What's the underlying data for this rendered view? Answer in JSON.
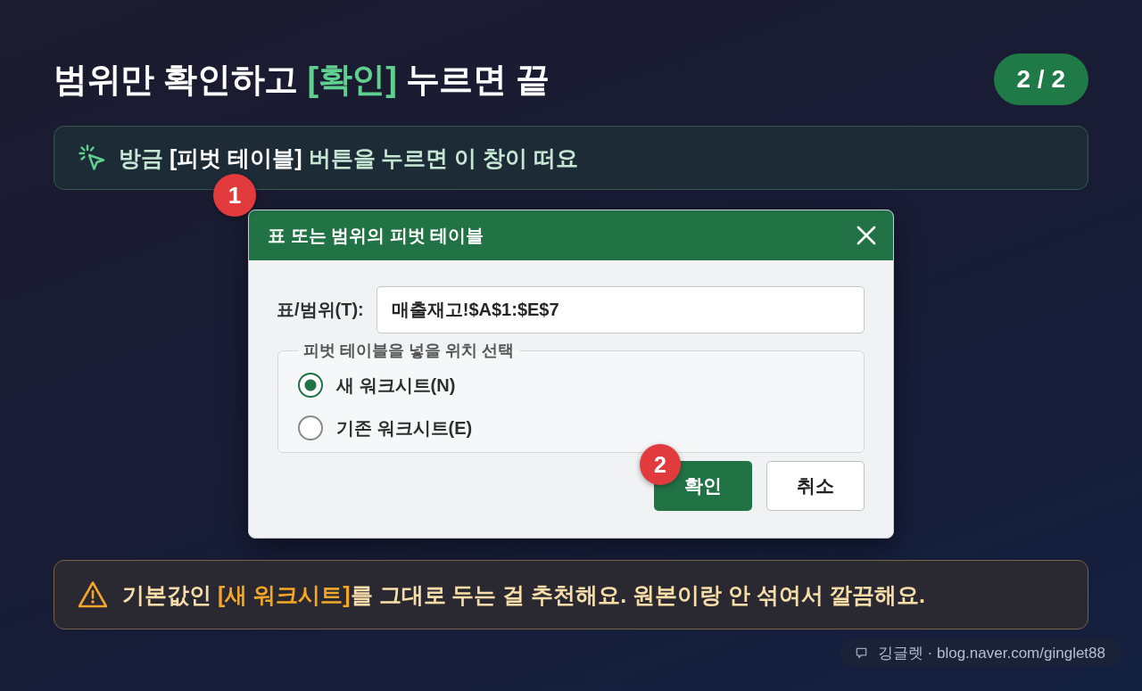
{
  "slide": {
    "title": "범위만 확인하고 **[확인]** 누르면 끝",
    "page": "2 / 2"
  },
  "tip": {
    "text": "방금 **[피벗 테이블]** 버튼을 누르면 이 창이 떠요",
    "marker": "1"
  },
  "dialog": {
    "title": "표 또는 범위의 피벗 테이블",
    "range": {
      "label": "표/범위(T):",
      "value": "매출재고!$A$1:$E$7"
    },
    "placement": {
      "legend": "피벗 테이블을 넣을 위치 선택",
      "options": [
        {
          "label": "새 워크시트(N)",
          "selected": true
        },
        {
          "label": "기존 워크시트(E)",
          "selected": false
        }
      ]
    },
    "buttons": [
      {
        "label": "확인",
        "kind": "primary",
        "marker": "2"
      },
      {
        "label": "취소",
        "kind": "secondary"
      }
    ]
  },
  "warning": {
    "text": "기본값인 **[새 워크시트]**를 그대로 두는 걸 추천해요. 원본이랑 안 섞여서 깔끔해요."
  },
  "credit": "깅글렛 · blog.naver.com/ginglet88"
}
